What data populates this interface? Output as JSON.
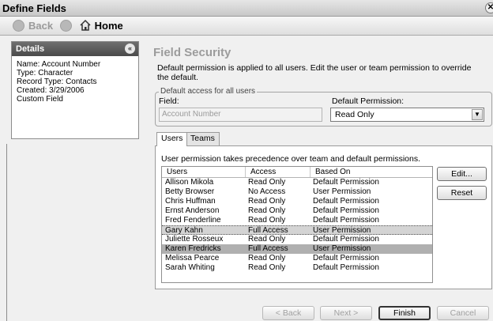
{
  "window": {
    "title": "Define Fields",
    "close_glyph": "✕"
  },
  "nav": {
    "back_label": "Back",
    "home_label": "Home"
  },
  "details": {
    "header": "Details",
    "collapse_glyph": "«",
    "lines": [
      "Name: Account Number",
      "Type: Character",
      "Record Type: Contacts",
      "Created: 3/29/2006",
      "Custom Field"
    ]
  },
  "field_security": {
    "title": "Field Security",
    "description": "Default permission is applied to all users. Edit the user or team permission to override the default.",
    "default_access": {
      "legend": "Default access for all users",
      "field_label": "Field:",
      "field_value": "Account Number",
      "permission_label": "Default Permission:",
      "permission_value": "Read Only"
    }
  },
  "tabs": [
    {
      "label": "Users"
    },
    {
      "label": "Teams"
    }
  ],
  "users_tab": {
    "description": "User permission takes precedence over team and default permissions.",
    "columns": [
      "Users",
      "Access",
      "Based On"
    ],
    "rows": [
      {
        "user": "Allison Mikola",
        "access": "Read Only",
        "based_on": "Default Permission"
      },
      {
        "user": "Betty Browser",
        "access": "No Access",
        "based_on": "User Permission"
      },
      {
        "user": "Chris Huffman",
        "access": "Read Only",
        "based_on": "Default Permission"
      },
      {
        "user": "Ernst Anderson",
        "access": "Read Only",
        "based_on": "Default Permission"
      },
      {
        "user": "Fred Fenderline",
        "access": "Read Only",
        "based_on": "Default Permission"
      },
      {
        "user": "Gary Kahn",
        "access": "Full Access",
        "based_on": "User Permission"
      },
      {
        "user": "Juliette Rosseux",
        "access": "Read Only",
        "based_on": "Default Permission"
      },
      {
        "user": "Karen Fredricks",
        "access": "Full Access",
        "based_on": "User Permission"
      },
      {
        "user": "Melissa Pearce",
        "access": "Read Only",
        "based_on": "Default Permission"
      },
      {
        "user": "Sarah Whiting",
        "access": "Read Only",
        "based_on": "Default Permission"
      }
    ],
    "edit_button": "Edit...",
    "reset_button": "Reset"
  },
  "wizard": {
    "back": "< Back",
    "next": "Next >",
    "finish": "Finish",
    "cancel": "Cancel"
  }
}
